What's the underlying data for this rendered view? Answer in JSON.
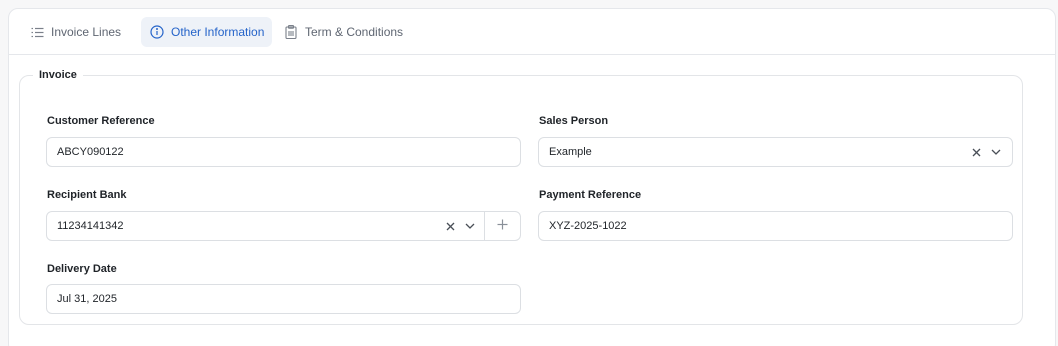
{
  "tabs": [
    {
      "label": "Invoice Lines",
      "icon": "list-icon",
      "active": false
    },
    {
      "label": "Other Information",
      "icon": "info-icon",
      "active": true
    },
    {
      "label": "Term & Conditions",
      "icon": "clipboard-icon",
      "active": false
    }
  ],
  "section": {
    "legend": "Invoice"
  },
  "fields": {
    "customer_reference": {
      "label": "Customer Reference",
      "value": "ABCY090122"
    },
    "sales_person": {
      "label": "Sales Person",
      "value": "Example"
    },
    "recipient_bank": {
      "label": "Recipient Bank",
      "value": "11234141342"
    },
    "payment_reference": {
      "label": "Payment Reference",
      "value": "XYZ-2025-1022"
    },
    "delivery_date": {
      "label": "Delivery Date",
      "value": "Jul 31, 2025"
    }
  },
  "colors": {
    "accent": "#2463c9",
    "border": "#dcdfe3",
    "muted_text": "#5f6672"
  }
}
